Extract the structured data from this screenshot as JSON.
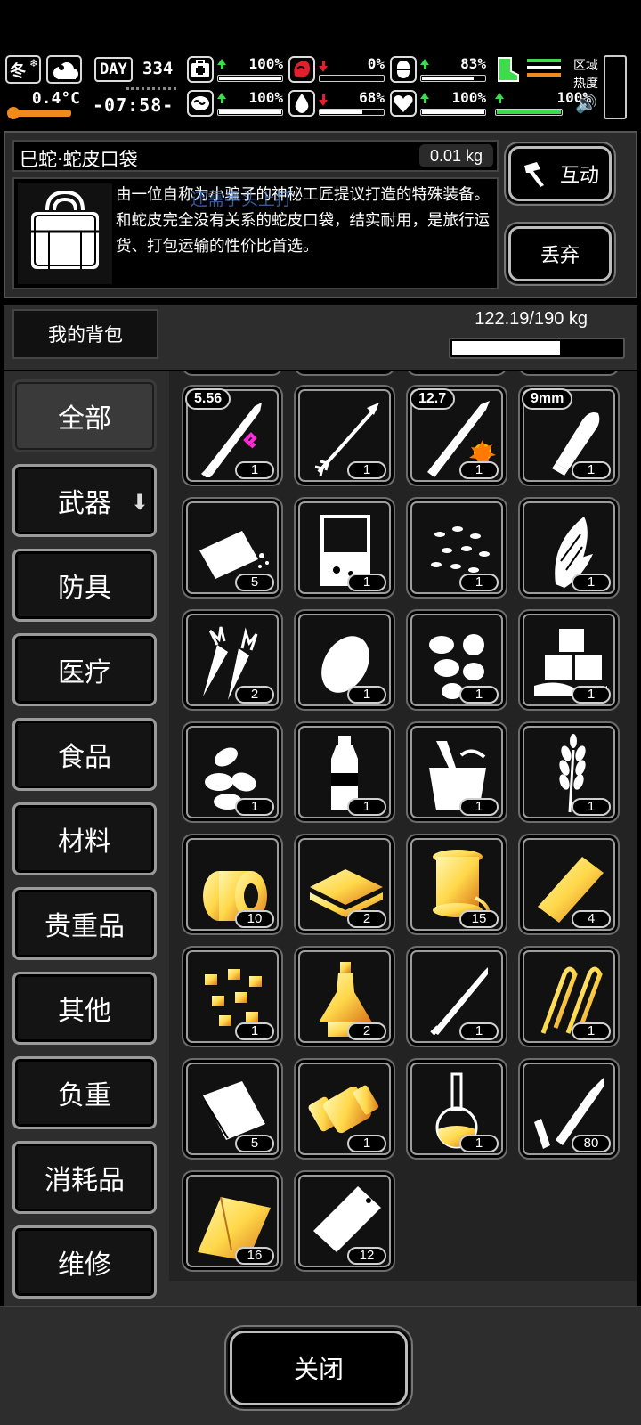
{
  "status": {
    "season": "冬",
    "temperature": "0.4°C",
    "day_label": "DAY",
    "day_number": "334",
    "time": "-07:58-",
    "stats": [
      {
        "name": "health",
        "value": "100%",
        "trend": "up",
        "fill": 1.0
      },
      {
        "name": "hunger",
        "value": "0%",
        "trend": "down",
        "fill": 0.0
      },
      {
        "name": "immunity",
        "value": "83%",
        "trend": "up",
        "fill": 0.83
      },
      {
        "name": "stamina",
        "value": "100%",
        "trend": "up",
        "fill": 1.0
      },
      {
        "name": "sanity",
        "value": "100%",
        "trend": "up",
        "fill": 1.0
      },
      {
        "name": "thirst",
        "value": "68%",
        "trend": "down",
        "fill": 0.68
      },
      {
        "name": "mood",
        "value": "100%",
        "trend": "up",
        "fill": 1.0
      },
      {
        "name": "energy",
        "value": "100%",
        "trend": "up",
        "fill": 1.0
      }
    ],
    "zone_heat_label": "区域热度",
    "colors": {
      "up": "#3ddc4a",
      "down": "#e0202c",
      "boot": "#3ddc4a"
    }
  },
  "item": {
    "name": "巳蛇·蛇皮口袋",
    "weight": "0.01 kg",
    "description": "由一位自称为小骗子的神秘工匠提议打造的特殊装备。和蛇皮完全没有关系的蛇皮口袋，结实耐用，是旅行运货、打包运输的性价比首选。",
    "overlay_text": "还需手头上打",
    "interact_label": "互动",
    "discard_label": "丢弃",
    "icon": "bag-icon"
  },
  "bag": {
    "title": "我的背包",
    "capacity": "122.19/190 kg",
    "fill": 0.643
  },
  "categories": [
    {
      "label": "全部",
      "selected": true
    },
    {
      "label": "武器",
      "selected": false,
      "has_arrow": true
    },
    {
      "label": "防具",
      "selected": false
    },
    {
      "label": "医疗",
      "selected": false
    },
    {
      "label": "食品",
      "selected": false
    },
    {
      "label": "材料",
      "selected": false
    },
    {
      "label": "贵重品",
      "selected": false
    },
    {
      "label": "其他",
      "selected": false
    },
    {
      "label": "负重",
      "selected": false
    },
    {
      "label": "消耗品",
      "selected": false
    },
    {
      "label": "维修",
      "selected": false
    }
  ],
  "items": [
    {
      "icon": "rifle-bullet-556-icon",
      "count": "1",
      "caliber": "5.56"
    },
    {
      "icon": "arrow-icon",
      "count": "1"
    },
    {
      "icon": "rifle-bullet-127-icon",
      "count": "1",
      "caliber": "12.7"
    },
    {
      "icon": "pistol-bullet-9mm-icon",
      "count": "1",
      "caliber": "9mm"
    },
    {
      "icon": "bread-icon",
      "count": "5"
    },
    {
      "icon": "beaker-icon",
      "count": "1"
    },
    {
      "icon": "seeds-icon",
      "count": "1"
    },
    {
      "icon": "corn-icon",
      "count": "1"
    },
    {
      "icon": "carrot-icon",
      "count": "2"
    },
    {
      "icon": "potato-icon",
      "count": "1"
    },
    {
      "icon": "beans-icon",
      "count": "1"
    },
    {
      "icon": "ice-icon",
      "count": "1"
    },
    {
      "icon": "almonds-icon",
      "count": "1"
    },
    {
      "icon": "water-bottle-icon",
      "count": "1"
    },
    {
      "icon": "bucket-icon",
      "count": "1"
    },
    {
      "icon": "wheat-icon",
      "count": "1"
    },
    {
      "icon": "tape-roll-icon",
      "count": "10",
      "tint": "gold"
    },
    {
      "icon": "fabric-stack-icon",
      "count": "2",
      "tint": "gold"
    },
    {
      "icon": "thread-spool-icon",
      "count": "15",
      "tint": "gold"
    },
    {
      "icon": "metal-plate-icon",
      "count": "4",
      "tint": "gold"
    },
    {
      "icon": "gold-nuggets-icon",
      "count": "1",
      "tint": "gold"
    },
    {
      "icon": "chemical-flask-icon",
      "count": "2",
      "tint": "gold"
    },
    {
      "icon": "needle-icon",
      "count": "1"
    },
    {
      "icon": "wire-clips-icon",
      "count": "1",
      "tint": "gold"
    },
    {
      "icon": "plastic-bag-icon",
      "count": "5"
    },
    {
      "icon": "bolt-nut-icon",
      "count": "1",
      "tint": "gold"
    },
    {
      "icon": "volumetric-flask-icon",
      "count": "1",
      "tint": "gold"
    },
    {
      "icon": "soldering-iron-icon",
      "count": "80"
    },
    {
      "icon": "fabric-sheet-icon",
      "count": "16",
      "tint": "gold"
    },
    {
      "icon": "zip-bag-icon",
      "count": "12"
    }
  ],
  "footer": {
    "close_label": "关闭"
  }
}
